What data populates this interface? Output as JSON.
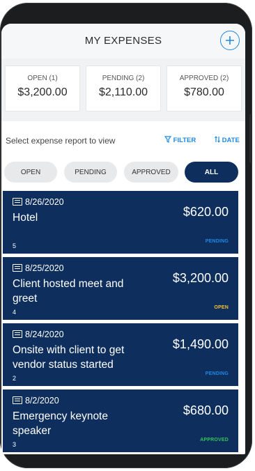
{
  "header": {
    "title": "MY EXPENSES",
    "add_icon": "plus-circle-icon"
  },
  "summary": [
    {
      "label": "OPEN (1)",
      "amount": "$3,200.00"
    },
    {
      "label": "PENDING (2)",
      "amount": "$2,110.00"
    },
    {
      "label": "APPROVED (2)",
      "amount": "$780.00"
    }
  ],
  "select_row": {
    "text": "Select expense report to view",
    "filter_label": "FILTER",
    "filter_icon": "filter-icon",
    "date_label": "DATE",
    "sort_icon": "sort-icon"
  },
  "tabs": [
    {
      "label": "OPEN",
      "active": false
    },
    {
      "label": "PENDING",
      "active": false
    },
    {
      "label": "APPROVED",
      "active": false
    },
    {
      "label": "ALL",
      "active": true
    }
  ],
  "reports": [
    {
      "date": "8/26/2020",
      "name": "Hotel",
      "amount": "$620.00",
      "count": "5",
      "status": "PENDING"
    },
    {
      "date": "8/25/2020",
      "name": "Client hosted meet and greet",
      "amount": "$3,200.00",
      "count": "4",
      "status": "OPEN"
    },
    {
      "date": "8/24/2020",
      "name": "Onsite with client to get vendor status started",
      "amount": "$1,490.00",
      "count": "2",
      "status": "PENDING"
    },
    {
      "date": "8/2/2020",
      "name": "Emergency keynote speaker",
      "amount": "$680.00",
      "count": "3",
      "status": "APPROVED"
    }
  ],
  "colors": {
    "accent": "#1e88e5",
    "navy": "#0e2f5e",
    "status_pending": "#1e88e5",
    "status_open": "#f2c230",
    "status_approved": "#36c25a"
  }
}
